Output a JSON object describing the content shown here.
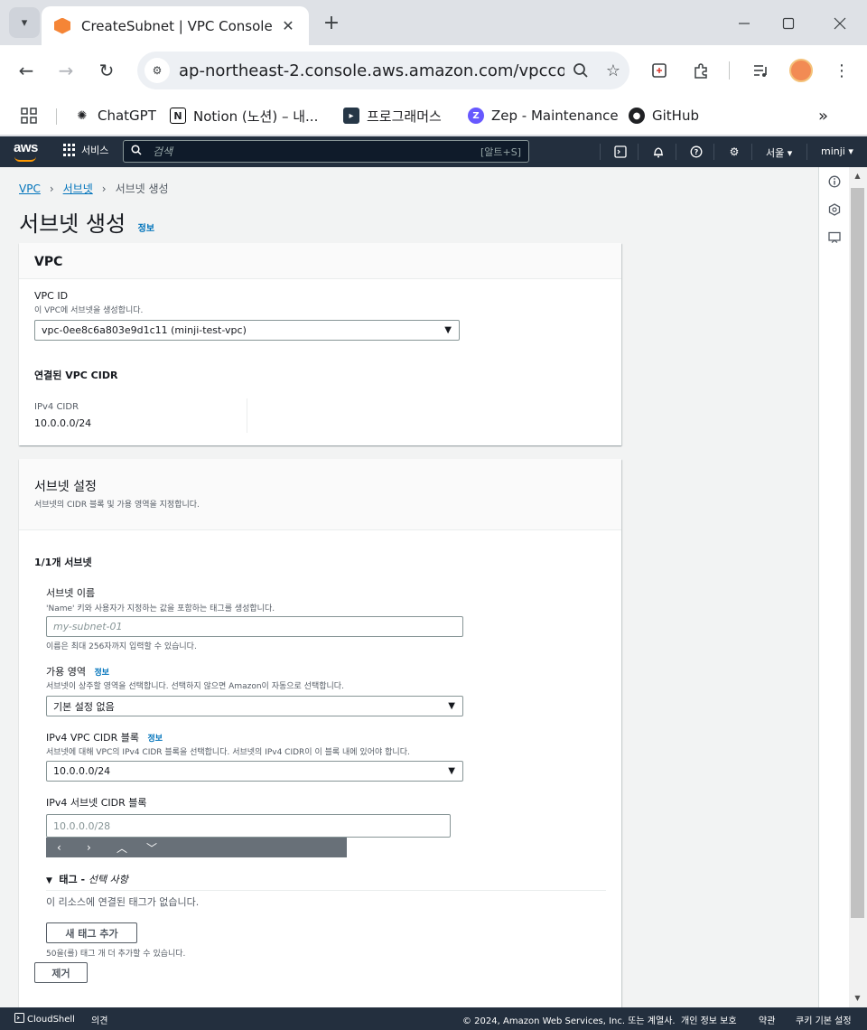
{
  "browser": {
    "tab_title": "CreateSubnet | VPC Console",
    "url": "ap-northeast-2.console.aws.amazon.com/vpccon...",
    "bookmarks": [
      {
        "label": "ChatGPT",
        "icon": "openai-icon"
      },
      {
        "label": "Notion (노션) – 내...",
        "icon": "notion-icon"
      },
      {
        "label": "프로그래머스",
        "icon": "programmers-icon"
      },
      {
        "label": "Zep - Maintenance",
        "icon": "zep-icon"
      },
      {
        "label": "GitHub",
        "icon": "github-icon"
      }
    ]
  },
  "aws_nav": {
    "logo": "aws",
    "services_label": "서비스",
    "search_placeholder": "검색",
    "search_shortcut": "[알트+S]",
    "region": "서울 ▾",
    "user": "minji ▾"
  },
  "breadcrumb": {
    "items": [
      "VPC",
      "서브넷",
      "서브넷 생성"
    ]
  },
  "page": {
    "title": "서브넷 생성",
    "info_label": "정보"
  },
  "vpc_panel": {
    "heading": "VPC",
    "vpc_id_label": "VPC ID",
    "vpc_id_desc": "이 VPC에 서브넷을 생성합니다.",
    "vpc_id_value": "vpc-0ee8c6a803e9d1c11 (minji-test-vpc)",
    "cidr_heading": "연결된 VPC CIDR",
    "ipv4_cidr_label": "IPv4 CIDR",
    "ipv4_cidr_value": "10.0.0.0/24"
  },
  "subnet_panel": {
    "heading": "서브넷 설정",
    "desc": "서브넷의 CIDR 블록 및 가용 영역을 지정합니다.",
    "count_label": "1/1개 서브넷",
    "name_label": "서브넷 이름",
    "name_desc": "'Name' 키와 사용자가 지정하는 값을 포함하는 태그를 생성합니다.",
    "name_placeholder": "my-subnet-01",
    "name_hint": "이름은 최대 256자까지 입력할 수 있습니다.",
    "az_label": "가용 영역",
    "az_info": "정보",
    "az_desc": "서브넷이 상주할 영역을 선택합니다. 선택하지 않으면 Amazon이 자동으로 선택합니다.",
    "az_value": "기본 설정 없음",
    "vpc_cidr_label": "IPv4 VPC CIDR 블록",
    "vpc_cidr_info": "정보",
    "vpc_cidr_desc": "서브넷에 대해 VPC의 IPv4 CIDR 블록을 선택합니다. 서브넷의 IPv4 CIDR이 이 블록 내에 있어야 합니다.",
    "vpc_cidr_value": "10.0.0.0/24",
    "subnet_cidr_label": "IPv4 서브넷 CIDR 블록",
    "subnet_cidr_placeholder": "10.0.0.0/28",
    "tags_label": "태그 - ",
    "tags_optional": "선택 사항",
    "tags_empty": "이 리소스에 연결된 태그가 없습니다.",
    "add_tag_button": "새 태그 추가",
    "tags_hint": "50을(를) 태그 개 더 추가할 수 있습니다.",
    "remove_button": "제거"
  },
  "footer": {
    "cloudshell": "CloudShell",
    "feedback": "의견",
    "copyright": "© 2024, Amazon Web Services, Inc. 또는 계열사.",
    "privacy": "개인 정보 보호",
    "terms": "약관",
    "cookies": "쿠키 기본 설정"
  }
}
